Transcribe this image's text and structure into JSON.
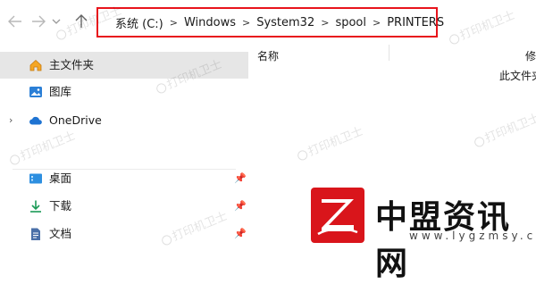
{
  "breadcrumb": {
    "segments": [
      "系统 (C:)",
      "Windows",
      "System32",
      "spool",
      "PRINTERS"
    ],
    "separator": ">"
  },
  "sidebar": {
    "items": [
      {
        "label": "主文件夹"
      },
      {
        "label": "图库"
      },
      {
        "label": "OneDrive"
      },
      {
        "label": "桌面"
      },
      {
        "label": "下载"
      },
      {
        "label": "文档"
      }
    ]
  },
  "content": {
    "column_name": "名称",
    "column_next": "修",
    "empty_message": "此文件夹"
  },
  "watermark": {
    "text": "打印机卫士"
  },
  "logo": {
    "name": "中盟资讯网",
    "url": "www.lygzmsy.com"
  },
  "colors": {
    "highlight_border": "#e8141c",
    "selected_bg": "#e6e6e6",
    "folder_yellow": "#f6c445"
  }
}
